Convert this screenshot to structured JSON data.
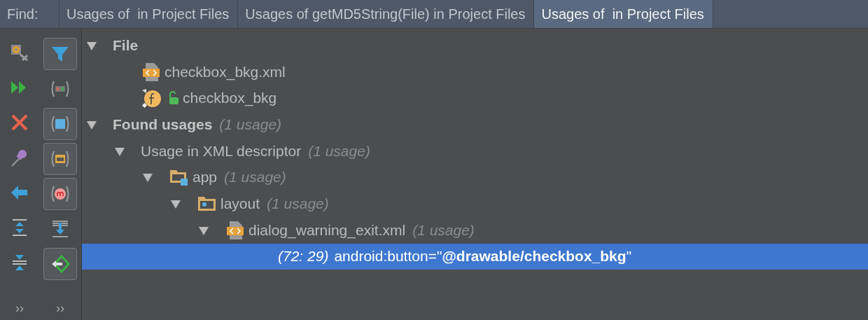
{
  "find_label": "Find:",
  "tabs": [
    {
      "label": "Usages of  in Project Files",
      "selected": false
    },
    {
      "label": "Usages of getMD5String(File) in Project Files",
      "selected": false
    },
    {
      "label": "Usages of  in Project Files",
      "selected": true
    }
  ],
  "toggles": [
    {
      "on": true
    },
    {
      "on": false
    },
    {
      "on": true
    },
    {
      "on": true
    },
    {
      "on": true
    },
    {
      "on": false
    },
    {
      "on": true
    }
  ],
  "left_more": "››",
  "right_more": "››",
  "tree": [
    {
      "kind": "group",
      "label": "File",
      "expanded": true,
      "selected": false,
      "children": [
        {
          "kind": "xml-file",
          "label": "checkbox_bkg.xml",
          "selected": false
        },
        {
          "kind": "resource",
          "label": "checkbox_bkg",
          "selected": false
        }
      ]
    },
    {
      "kind": "group",
      "label": "Found usages",
      "count": "(1 usage)",
      "expanded": true,
      "selected": false,
      "children": [
        {
          "kind": "category",
          "label": "Usage in XML descriptor",
          "count": "(1 usage)",
          "expanded": true,
          "selected": false,
          "children": [
            {
              "kind": "module",
              "label": "app",
              "count": "(1 usage)",
              "expanded": true,
              "selected": false,
              "children": [
                {
                  "kind": "folder",
                  "label": "layout",
                  "count": "(1 usage)",
                  "expanded": true,
                  "selected": false,
                  "children": [
                    {
                      "kind": "xml-file",
                      "label": "dialog_warning_exit.xml",
                      "count": "(1 usage)",
                      "expanded": true,
                      "selected": false,
                      "children": [
                        {
                          "kind": "usage",
                          "location": "(72: 29)",
                          "label": "android:button=\"**@drawable/checkbox_bkg**\"",
                          "selected": true
                        }
                      ]
                    }
                  ]
                }
              ]
            }
          ]
        }
      ]
    }
  ]
}
